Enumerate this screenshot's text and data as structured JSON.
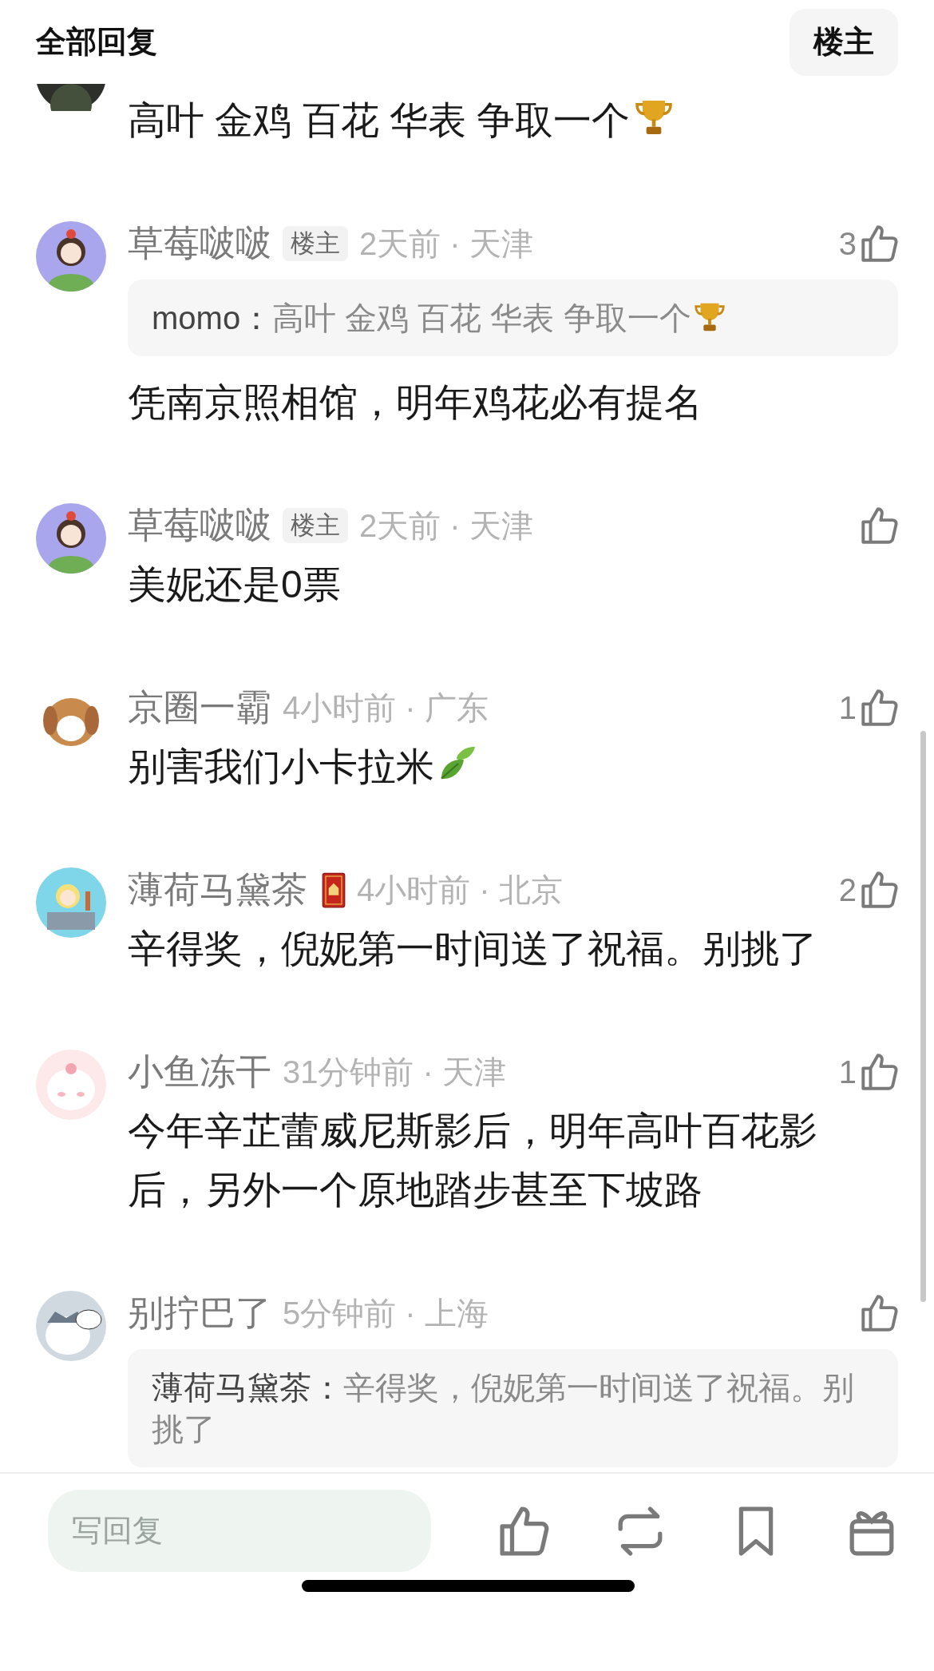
{
  "header": {
    "title": "全部回复",
    "filter_button": "楼主"
  },
  "comments": [
    {
      "body": "高叶 金鸡 百花 华表 争取一个",
      "emoji": {
        "kind": "trophy"
      }
    },
    {
      "name": "草莓啵啵",
      "badge": "楼主",
      "meta": "2天前 · 天津",
      "likes": "3",
      "quote": {
        "author": "momo：",
        "text": "高叶 金鸡 百花 华表 争取一个",
        "emoji": {
          "kind": "trophy"
        }
      },
      "body": "凭南京照相馆，明年鸡花必有提名"
    },
    {
      "name": "草莓啵啵",
      "badge": "楼主",
      "meta": "2天前 · 天津",
      "body": "美妮还是0票"
    },
    {
      "name": "京圈一霸",
      "meta": "4小时前 · 广东",
      "likes": "1",
      "body": "别害我们小卡拉米",
      "emoji": {
        "kind": "leaf"
      }
    },
    {
      "name": "薄荷马黛茶",
      "medal": true,
      "meta": "4小时前 · 北京",
      "likes": "2",
      "body": "辛得奖，倪妮第一时间送了祝福。别挑了"
    },
    {
      "name": "小鱼冻干",
      "meta": "31分钟前 · 天津",
      "likes": "1",
      "body": "今年辛芷蕾威尼斯影后，明年高叶百花影后，另外一个原地踏步甚至下坡路"
    },
    {
      "name": "别拧巴了",
      "meta": "5分钟前 · 上海",
      "quote": {
        "author": "薄荷马黛茶：",
        "text": "辛得奖，倪妮第一时间送了祝福。别挑了"
      }
    }
  ],
  "reply_bar": {
    "placeholder": "写回复"
  }
}
